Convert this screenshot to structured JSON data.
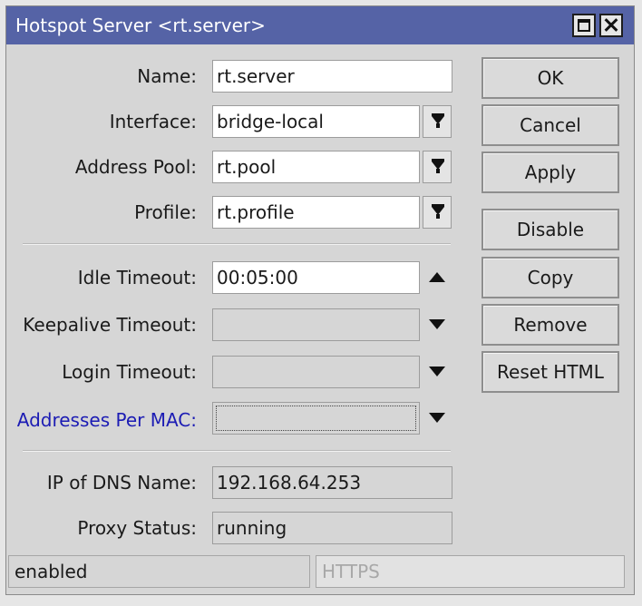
{
  "window": {
    "title": "Hotspot Server <rt.server>"
  },
  "fields": {
    "name": {
      "label": "Name:",
      "value": "rt.server"
    },
    "interface": {
      "label": "Interface:",
      "value": "bridge-local"
    },
    "address_pool": {
      "label": "Address Pool:",
      "value": "rt.pool"
    },
    "profile": {
      "label": "Profile:",
      "value": "rt.profile"
    },
    "idle_timeout": {
      "label": "Idle Timeout:",
      "value": "00:05:00"
    },
    "keepalive_timeout": {
      "label": "Keepalive Timeout:",
      "value": ""
    },
    "login_timeout": {
      "label": "Login Timeout:",
      "value": ""
    },
    "addresses_per_mac": {
      "label": "Addresses Per MAC:",
      "value": ""
    },
    "ip_of_dns_name": {
      "label": "IP of DNS Name:",
      "value": "192.168.64.253"
    },
    "proxy_status": {
      "label": "Proxy Status:",
      "value": "running"
    }
  },
  "buttons": {
    "ok": "OK",
    "cancel": "Cancel",
    "apply": "Apply",
    "disable": "Disable",
    "copy": "Copy",
    "remove": "Remove",
    "reset_html": "Reset HTML"
  },
  "statusbar": {
    "state": "enabled",
    "protocol": "HTTPS"
  },
  "icons": {
    "title_buttons": [
      "maximize-icon",
      "close-icon"
    ],
    "dropdown": "dropdown-arrow-icon",
    "spinner_up": "arrow-up-icon",
    "spinner_down": "arrow-down-icon"
  },
  "colors": {
    "titlebar": "#5563a6",
    "highlight_label": "#1c1cb4",
    "window_bg": "#d6d6d6"
  }
}
